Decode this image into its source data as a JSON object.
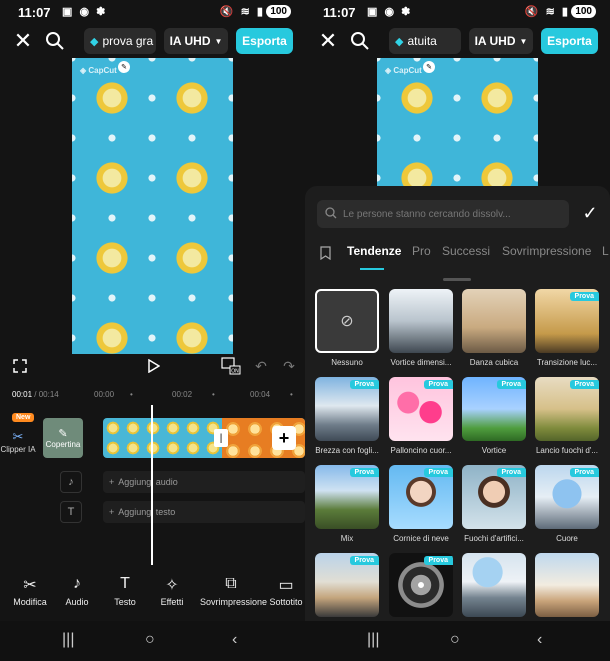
{
  "status": {
    "time": "11:07",
    "battery": "100"
  },
  "topbar": {
    "project_name": "prova gra",
    "project_name_right": "atuita",
    "quality": "IA UHD",
    "export_label": "Esporta"
  },
  "timeline": {
    "current_time": "00:01",
    "total_time": "00:14",
    "ruler": [
      "00:00",
      "00:02",
      "00:04"
    ],
    "clipper_label": "Clipper IA",
    "new_badge": "New",
    "cover_label": "Copertina",
    "add_audio": "Aggiungi audio",
    "add_text": "Aggiungi testo"
  },
  "toolbar": {
    "items": [
      {
        "label": "Modifica",
        "icon": "scissors-icon"
      },
      {
        "label": "Audio",
        "icon": "music-note-icon"
      },
      {
        "label": "Testo",
        "icon": "text-icon"
      },
      {
        "label": "Effetti",
        "icon": "sparkle-icon"
      },
      {
        "label": "Sovrimpressione",
        "icon": "overlay-icon"
      },
      {
        "label": "Sottotito",
        "icon": "subtitle-icon"
      }
    ]
  },
  "sheet": {
    "search_placeholder": "Le persone stanno cercando dissolv...",
    "tabs": [
      "Tendenze",
      "Pro",
      "Successi",
      "Sovrimpressione",
      "L"
    ],
    "active_tab": "Tendenze",
    "prova_label": "Prova",
    "effects": [
      {
        "label": "Nessuno",
        "prova": false
      },
      {
        "label": "Vortice dimensi...",
        "prova": false
      },
      {
        "label": "Danza cubica",
        "prova": false
      },
      {
        "label": "Transizione luc...",
        "prova": true
      },
      {
        "label": "Brezza con fogli...",
        "prova": true
      },
      {
        "label": "Palloncino cuor...",
        "prova": true
      },
      {
        "label": "Vortice",
        "prova": true
      },
      {
        "label": "Lancio fuochi d'...",
        "prova": true
      },
      {
        "label": "Mix",
        "prova": true
      },
      {
        "label": "Cornice di neve",
        "prova": true
      },
      {
        "label": "Fuochi d'artifici...",
        "prova": true
      },
      {
        "label": "Cuore",
        "prova": true
      },
      {
        "label": "",
        "prova": true
      },
      {
        "label": "",
        "prova": true
      },
      {
        "label": "",
        "prova": false
      },
      {
        "label": "",
        "prova": false
      }
    ]
  },
  "colors": {
    "accent": "#27c9de",
    "background": "#141414",
    "new_badge": "#ff8a1f"
  }
}
